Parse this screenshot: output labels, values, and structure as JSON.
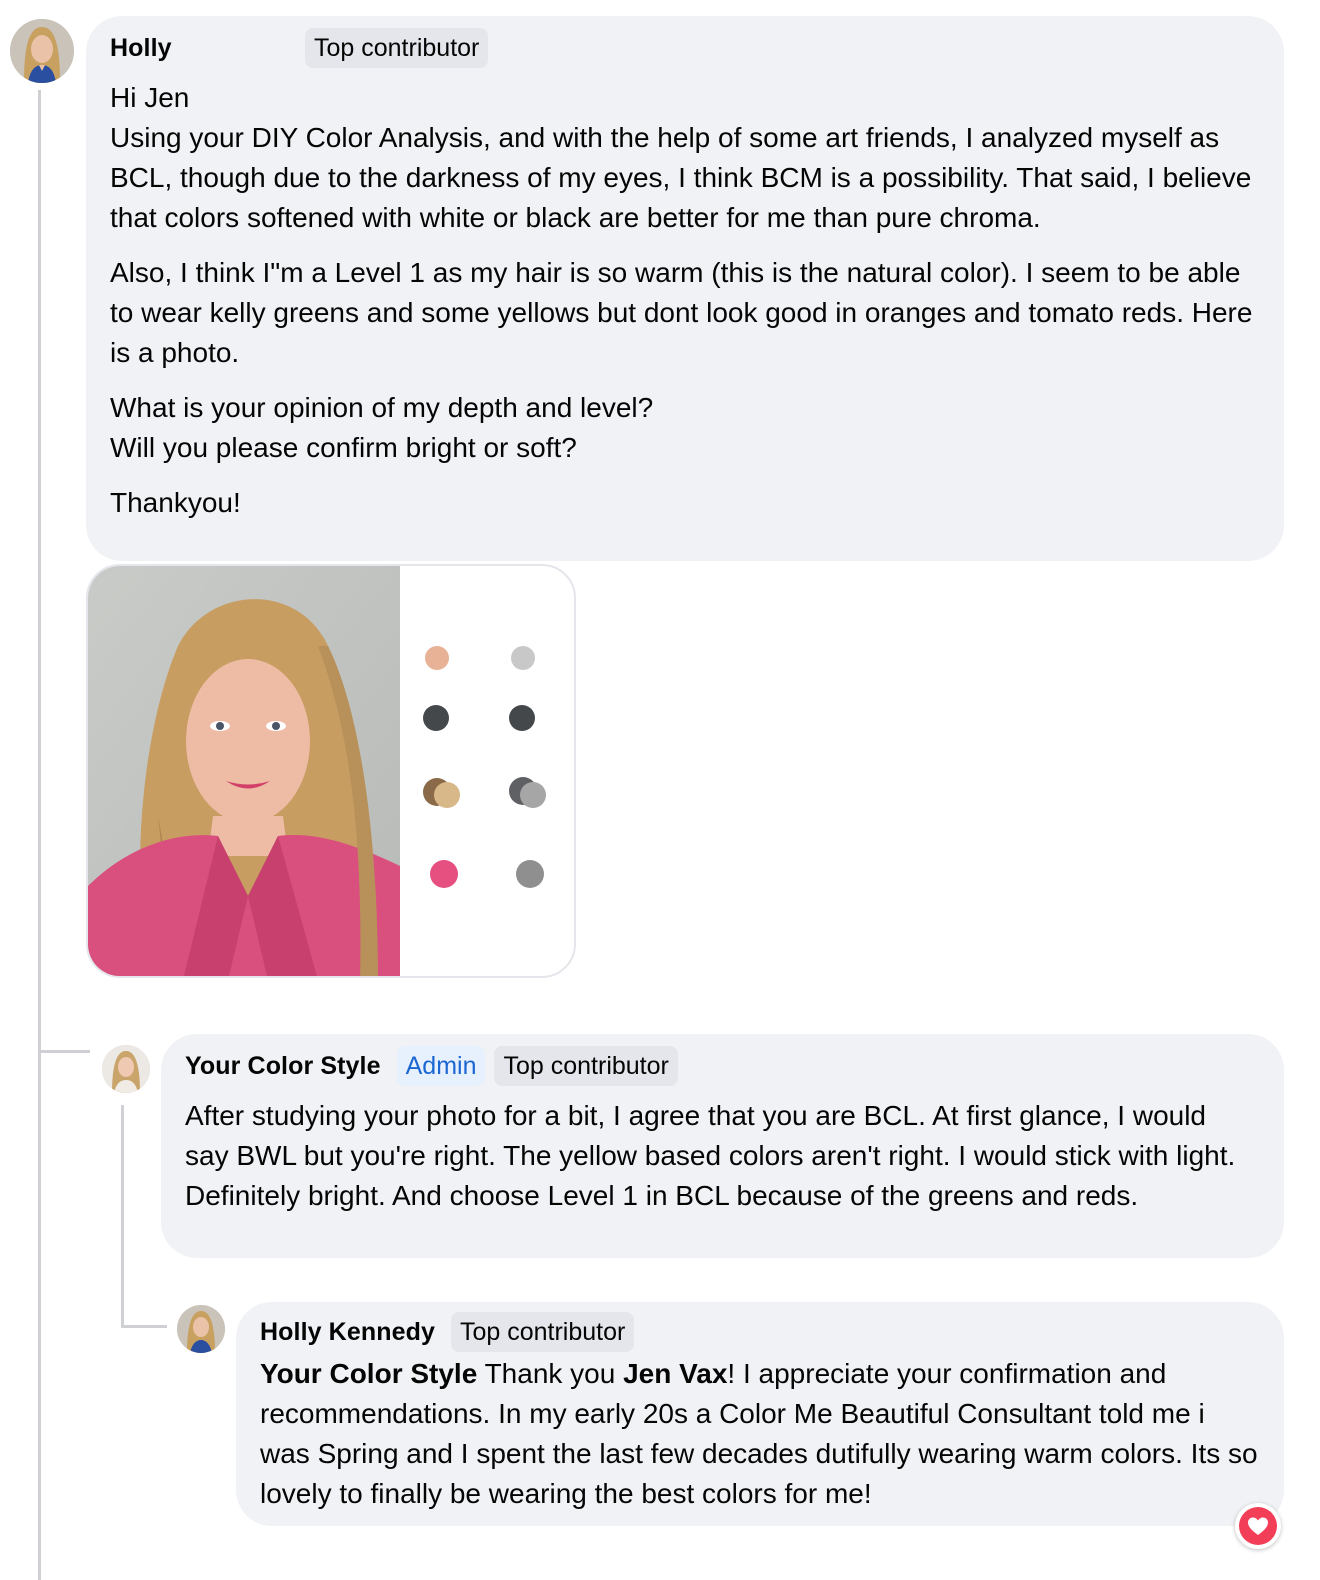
{
  "comment": {
    "author": "Holly",
    "badge": "Top contributor",
    "paragraphs": [
      [
        "Hi Jen",
        "Using your DIY Color Analysis, and with the help of some art friends, I analyzed myself as BCL, though due to the darkness of my eyes, I think BCM is a possibility. That said, I believe that colors softened with white or black are better for me than pure chroma."
      ],
      [
        "Also, I think I\"m a Level 1 as my hair is so warm (this is the natural color). I seem to be able to wear kelly greens and some yellows but dont look good in oranges and tomato reds. Here is a photo."
      ],
      [
        "What is your opinion of my depth and level?",
        "Will you please confirm bright or soft?"
      ],
      [
        "Thankyou!"
      ]
    ]
  },
  "reply1": {
    "author": "Your Color Style",
    "badge_admin": "Admin",
    "badge": "Top contributor",
    "text": "After studying your photo for a bit, I agree that you are BCL. At first glance, I would say BWL but you're right. The yellow based colors aren't right. I would stick with light. Definitely bright. And choose Level 1 in BCL because of the greens and reds."
  },
  "reply2": {
    "author": "Holly Kennedy",
    "badge": "Top contributor",
    "mention1": "Your Color Style",
    "text1": " Thank you ",
    "mention2": "Jen Vax",
    "text2": "! I appreciate your confirmation and recommendations. In my early 20s a Color Me Beautiful Consultant told me i was Spring and I spent the last few decades dutifully wearing warm colors. Its so lovely to finally be wearing the best colors for me!"
  },
  "colors": {
    "bubble_bg": "#f0f2f5",
    "admin_text": "#1b66d2",
    "reaction_heart": "#f33e58",
    "swatch_peach": "#e7b296",
    "swatch_light_gray": "#c8c8c8",
    "swatch_charcoal": "#45484b",
    "swatch_brown": "#8a6a48",
    "swatch_tan": "#d8b888",
    "swatch_gray": "#8f8f8f",
    "swatch_pink": "#e55080"
  },
  "reaction": "heart-icon"
}
